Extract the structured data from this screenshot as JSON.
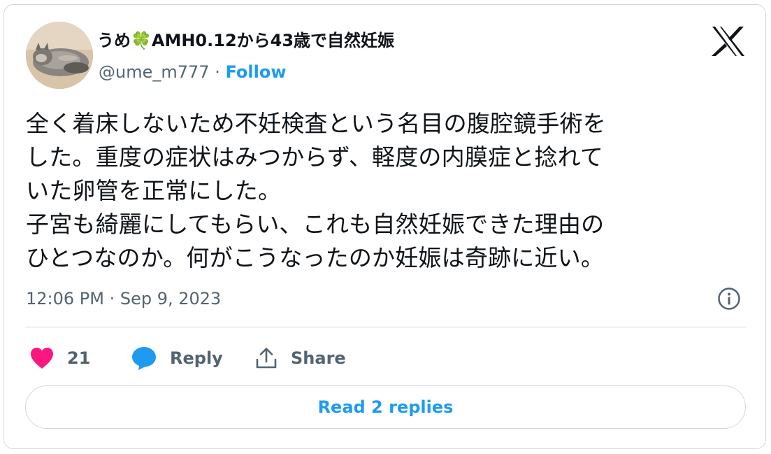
{
  "author": {
    "display_name": "うめ🍀AMH0.12から43歳で自然妊娠",
    "handle": "@ume_m777",
    "separator": "·",
    "follow_label": "Follow"
  },
  "tweet": {
    "lines": [
      "全く着床しないため不妊検査という名目の腹腔鏡手術を",
      "した。重度の症状はみつからず、軽度の内膜症と捻れて",
      "いた卵管を正常にした。",
      "子宮も綺麗にしてもらい、これも自然妊娠できた理由の",
      "ひとつなのか。何がこうなったのか妊娠は奇跡に近い。"
    ],
    "timestamp": "12:06 PM · Sep 9, 2023"
  },
  "actions": {
    "like_count": "21",
    "reply_label": "Reply",
    "share_label": "Share"
  },
  "read_replies_label": "Read 2 replies",
  "icons": {
    "logo": "x-logo-icon",
    "info": "info-icon",
    "like": "heart-icon",
    "reply": "speech-bubble-icon",
    "share": "share-icon"
  },
  "colors": {
    "accent": "#1d9bf0",
    "like": "#f91880",
    "text": "#0f1419",
    "secondary": "#536471",
    "border": "#cfd9de"
  }
}
